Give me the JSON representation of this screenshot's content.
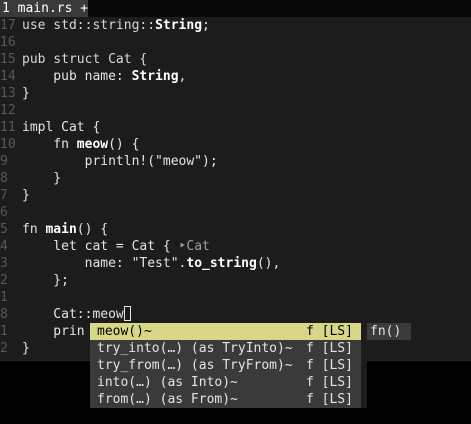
{
  "tab": {
    "label": "1 main.rs +"
  },
  "lines": [
    {
      "num": "17",
      "parts": [
        [
          "use std::string::",
          "kw"
        ],
        [
          "String",
          "ty"
        ],
        [
          ";",
          ""
        ]
      ]
    },
    {
      "num": "16",
      "parts": []
    },
    {
      "num": "15",
      "parts": [
        [
          "pub struct Cat {",
          "kw"
        ]
      ]
    },
    {
      "num": "14",
      "parts": [
        [
          "    pub name: ",
          ""
        ],
        [
          "String",
          "ty"
        ],
        [
          ",",
          ""
        ]
      ]
    },
    {
      "num": "13",
      "parts": [
        [
          "}",
          ""
        ]
      ]
    },
    {
      "num": "12",
      "parts": []
    },
    {
      "num": "11",
      "parts": [
        [
          "impl Cat {",
          ""
        ]
      ]
    },
    {
      "num": "10",
      "parts": [
        [
          "    fn ",
          ""
        ],
        [
          "meow",
          "fn"
        ],
        [
          "() {",
          ""
        ]
      ]
    },
    {
      "num": "9",
      "parts": [
        [
          "        println!(\"meow\");",
          ""
        ]
      ]
    },
    {
      "num": "8",
      "parts": [
        [
          "    }",
          ""
        ]
      ]
    },
    {
      "num": "7",
      "parts": [
        [
          "}",
          ""
        ]
      ]
    },
    {
      "num": "6",
      "parts": []
    },
    {
      "num": "5",
      "parts": [
        [
          "fn ",
          ""
        ],
        [
          "main",
          "fn"
        ],
        [
          "() {",
          ""
        ]
      ]
    },
    {
      "num": "4",
      "parts": [
        [
          "    let cat = Cat { ",
          ""
        ],
        [
          "‣Cat",
          "hint"
        ]
      ]
    },
    {
      "num": "3",
      "parts": [
        [
          "        name: \"Test\".",
          ""
        ],
        [
          "to_string",
          "fn"
        ],
        [
          "(),",
          ""
        ]
      ]
    },
    {
      "num": "2",
      "parts": [
        [
          "    };",
          ""
        ]
      ]
    },
    {
      "num": "1",
      "parts": []
    },
    {
      "num": "8",
      "parts": [
        [
          "    Cat::meow",
          ""
        ]
      ],
      "cursor": true
    },
    {
      "num": "1",
      "parts": [
        [
          "    prin",
          ""
        ]
      ]
    },
    {
      "num": "2",
      "parts": [
        [
          "}",
          ""
        ]
      ]
    }
  ],
  "completion": {
    "items": [
      {
        "word": "meow()~",
        "kind": "f [LS]",
        "selected": true
      },
      {
        "word": "try_into(…) (as TryInto)~",
        "kind": "f [LS]",
        "selected": false
      },
      {
        "word": "try_from(…) (as TryFrom)~",
        "kind": "f [LS]",
        "selected": false
      },
      {
        "word": "into(…) (as Into)~",
        "kind": "f [LS]",
        "selected": false
      },
      {
        "word": "from(…) (as From)~",
        "kind": "f [LS]",
        "selected": false
      }
    ],
    "preview": "fn()"
  },
  "colors": {
    "editor_bg": "#1c1c1c",
    "menu_bg": "#3a3a3a",
    "menu_selected_bg": "#d7d787",
    "line_number": "#585858"
  }
}
